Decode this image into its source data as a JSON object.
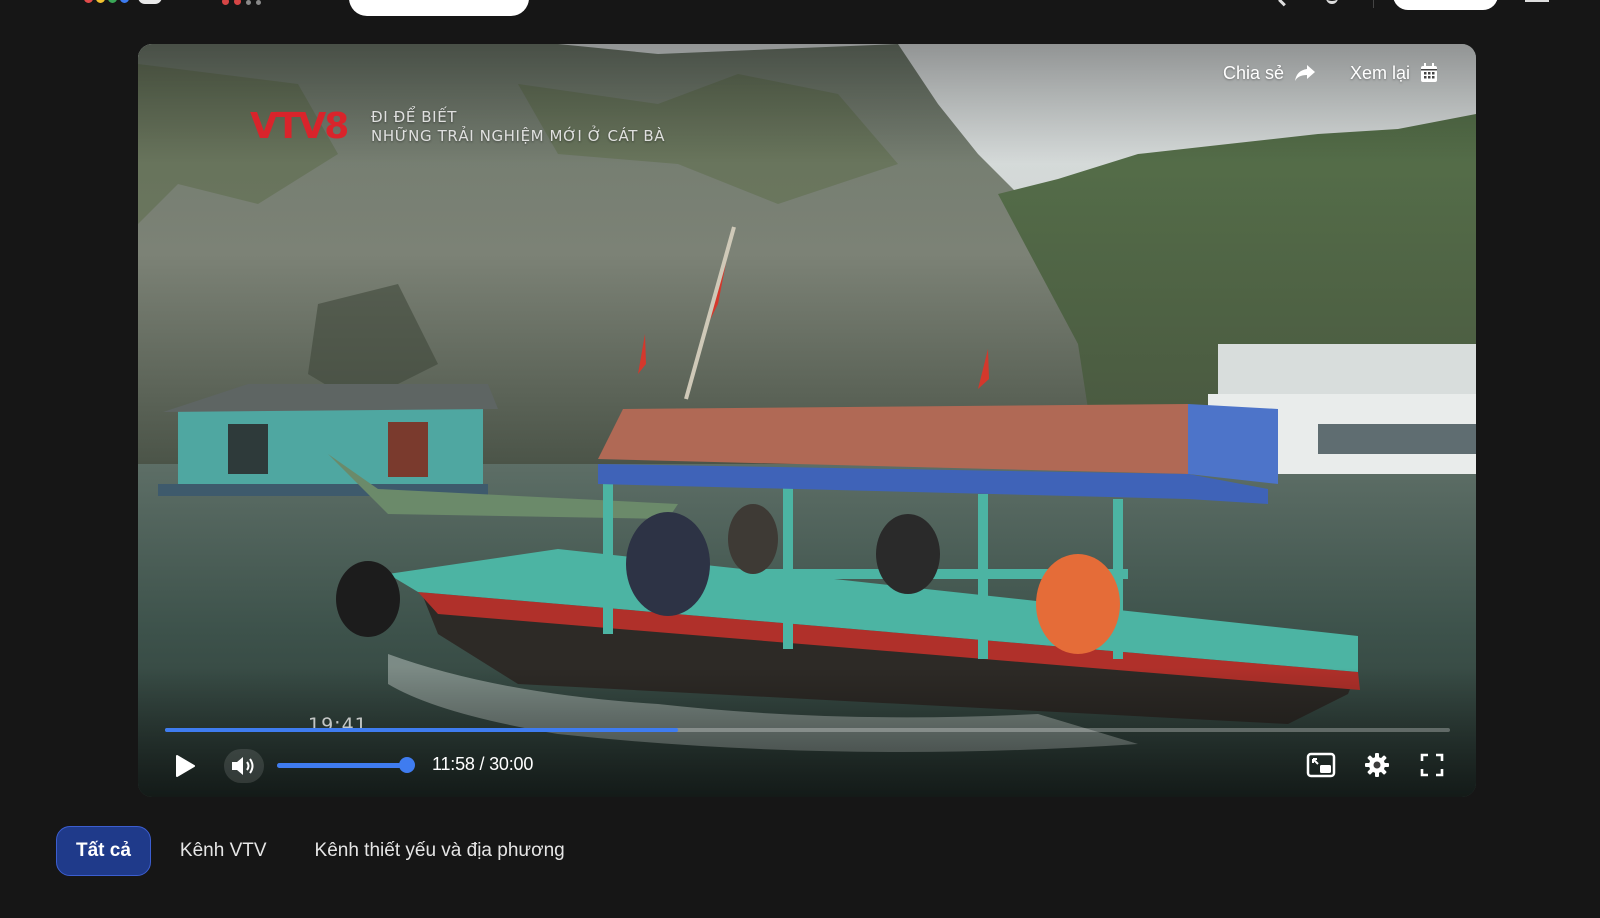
{
  "topbar": {
    "logo_icon": "site-logo",
    "search_icon": "search-icon",
    "user_icon": "user-icon",
    "menu_icon": "menu-icon"
  },
  "player": {
    "channel_logo_text": "VTV8",
    "program_line1": "ĐI ĐỂ BIẾT",
    "program_line2": "NHỮNG TRẢI NGHIỆM MỚI Ở CÁT BÀ",
    "burned_timestamp": "19:41",
    "share_label": "Chia sẻ",
    "replay_label": "Xem lại",
    "current_time": "11:58",
    "duration": "30:00",
    "time_display": "11:58 / 30:00",
    "progress_fraction": 0.3993,
    "volume_fraction": 1.0,
    "accent_color": "#3f7cf0"
  },
  "tabs": [
    {
      "label": "Tất cả",
      "active": true
    },
    {
      "label": "Kênh VTV",
      "active": false
    },
    {
      "label": "Kênh thiết yếu và địa phương",
      "active": false
    }
  ]
}
